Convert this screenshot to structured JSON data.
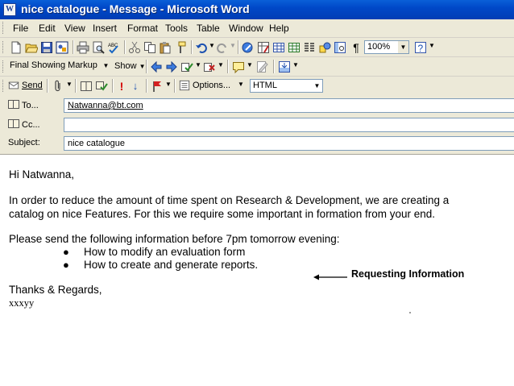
{
  "window": {
    "title": "nice catalogue - Message - Microsoft Word"
  },
  "menubar": {
    "items": [
      "File",
      "Edit",
      "View",
      "Insert",
      "Format",
      "Tools",
      "Table",
      "Window",
      "Help"
    ]
  },
  "toolbar": {
    "zoom": "100%",
    "review_mode": "Final Showing Markup",
    "show_label": "Show",
    "send_label": "Send",
    "options_label": "Options...",
    "format": "HTML",
    "help_icon": "?"
  },
  "header": {
    "to_label": "To...",
    "to_value": "Natwanna@bt.com",
    "cc_label": "Cc...",
    "cc_value": "",
    "subject_label": "Subject:",
    "subject_value": "nice catalogue"
  },
  "message": {
    "greeting": "Hi Natwanna,",
    "para1_line1": "In order to reduce the amount of time spent on Research & Development, we are creating a",
    "para1_line2": "catalog on nice Features. For this we require some important in formation from your end.",
    "para2": "Please send the following information before 7pm tomorrow evening:",
    "bullets": [
      "How to modify an evaluation form",
      "How to create and generate reports."
    ],
    "closing": "Thanks & Regards,",
    "signature": "xxxyy"
  },
  "annotation": {
    "label": "Requesting Information"
  }
}
